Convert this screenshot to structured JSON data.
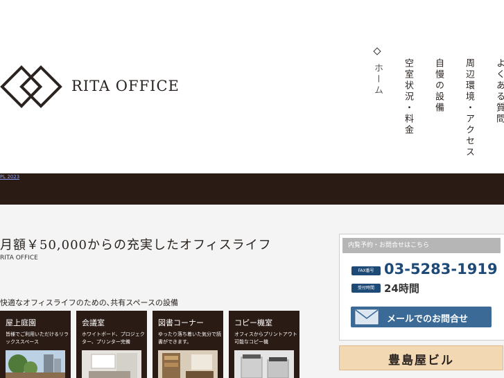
{
  "brand": {
    "logo_text": "RITA OFFICE"
  },
  "nav": {
    "home": "ホーム",
    "vacancy": "空室状況・料金",
    "facilities": "自慢の設備",
    "access": "周辺環境・アクセス",
    "faq": "よくある質問"
  },
  "band": {
    "link_text": "PL 2023"
  },
  "main": {
    "tagline": "月額￥50,000からの充実したオフィスライフ",
    "subtag": "RITA OFFICE",
    "section_title": "快適なオフィスライフのための､共有スペースの設備"
  },
  "cards": [
    {
      "title": "屋上庭園",
      "desc": "皆様でご利用いただけるリラックススペース"
    },
    {
      "title": "会議室",
      "desc": "ホワイトボード、プロジェクター、プリンター完備"
    },
    {
      "title": "図書コーナー",
      "desc": "ゆったり落ち着いた気分で読書ができます。"
    },
    {
      "title": "コピー機室",
      "desc": "オフィスからプリントアウト可能なコピー機"
    }
  ],
  "contact": {
    "heading": "内覧予約・お問合せはこちら",
    "fax_badge": "FAX番号",
    "fax_number": "03-5283-1919",
    "hours_badge": "受付時間",
    "hours": "24時間",
    "mail_button": "メールでのお問合せ"
  },
  "building": {
    "label": "豊島屋ビル"
  },
  "colors": {
    "dark": "#2b1b15",
    "accent": "#1e4a78",
    "mail_button": "#3b6a96"
  }
}
